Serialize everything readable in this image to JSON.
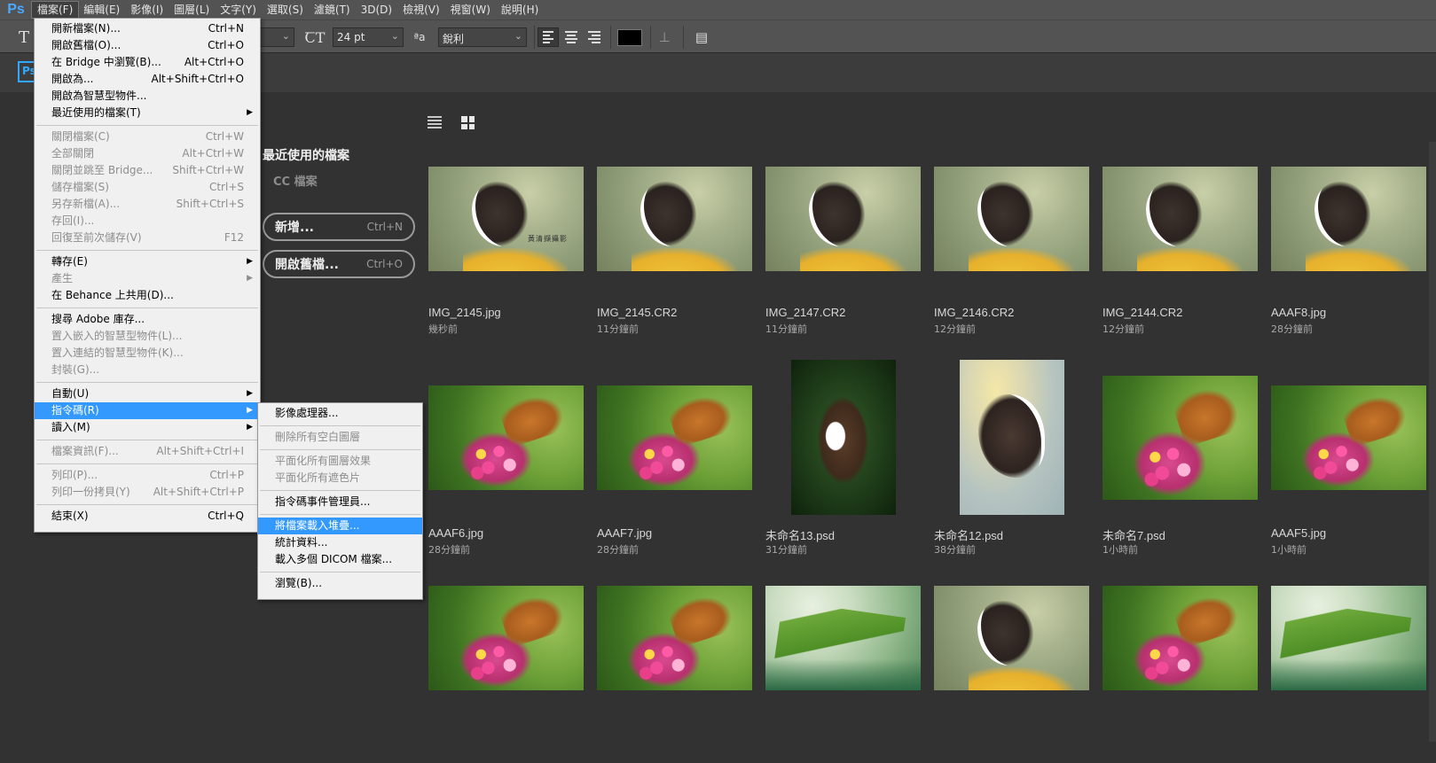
{
  "app": {
    "logo_text": "Ps",
    "accent": "#31a8ff",
    "menu_highlight": "#3399ff"
  },
  "menubar": {
    "items": [
      "檔案(F)",
      "編輯(E)",
      "影像(I)",
      "圖層(L)",
      "文字(Y)",
      "選取(S)",
      "濾鏡(T)",
      "3D(D)",
      "檢視(V)",
      "視窗(W)",
      "說明(H)"
    ]
  },
  "options_bar": {
    "tool_icon": "T",
    "font_size": "24 pt",
    "antialias_label": "ªa",
    "antialias_value": "銳利",
    "text_color": "#000000"
  },
  "home": {
    "tab_icon": "Ps",
    "nav": {
      "recent": "最近使用的檔案",
      "cc": "CC 檔案"
    },
    "buttons": [
      {
        "label": "新增...",
        "shortcut": "Ctrl+N"
      },
      {
        "label": "開啟舊檔...",
        "shortcut": "Ctrl+O"
      }
    ],
    "watermark": "黃清擷攝影",
    "files": [
      {
        "name": "IMG_2145.jpg",
        "time": "幾秒前",
        "img": "butterfly",
        "shape": "landscape"
      },
      {
        "name": "IMG_2145.CR2",
        "time": "11分鐘前",
        "img": "butterfly",
        "shape": "landscape"
      },
      {
        "name": "IMG_2147.CR2",
        "time": "11分鐘前",
        "img": "butterfly",
        "shape": "landscape"
      },
      {
        "name": "IMG_2146.CR2",
        "time": "12分鐘前",
        "img": "butterfly",
        "shape": "landscape"
      },
      {
        "name": "IMG_2144.CR2",
        "time": "12分鐘前",
        "img": "butterfly",
        "shape": "landscape"
      },
      {
        "name": "AAAF8.jpg",
        "time": "28分鐘前",
        "img": "butterfly",
        "shape": "landscape"
      },
      {
        "name": "AAAF6.jpg",
        "time": "28分鐘前",
        "img": "skipper",
        "shape": "landscape"
      },
      {
        "name": "AAAF7.jpg",
        "time": "28分鐘前",
        "img": "skipper",
        "shape": "landscape"
      },
      {
        "name": "未命名13.psd",
        "time": "31分鐘前",
        "img": "portrait-dark",
        "shape": "portrait"
      },
      {
        "name": "未命名12.psd",
        "time": "38分鐘前",
        "img": "portrait-light",
        "shape": "portrait"
      },
      {
        "name": "未命名7.psd",
        "time": "1小時前",
        "img": "skipper",
        "shape": "landscape2"
      },
      {
        "name": "AAAF5.jpg",
        "time": "1小時前",
        "img": "skipper",
        "shape": "landscape"
      },
      {
        "name": "",
        "time": "",
        "img": "skipper",
        "shape": "landscape"
      },
      {
        "name": "",
        "time": "",
        "img": "skipper",
        "shape": "landscape"
      },
      {
        "name": "",
        "time": "",
        "img": "grasshopper",
        "shape": "landscape"
      },
      {
        "name": "",
        "time": "",
        "img": "butterfly",
        "shape": "landscape"
      },
      {
        "name": "",
        "time": "",
        "img": "skipper",
        "shape": "landscape"
      },
      {
        "name": "",
        "time": "",
        "img": "grasshopper",
        "shape": "landscape"
      }
    ]
  },
  "file_menu": {
    "items": [
      {
        "label": "開新檔案(N)...",
        "shortcut": "Ctrl+N"
      },
      {
        "label": "開啟舊檔(O)...",
        "shortcut": "Ctrl+O"
      },
      {
        "label": "在 Bridge 中瀏覽(B)...",
        "shortcut": "Alt+Ctrl+O"
      },
      {
        "label": "開啟為...",
        "shortcut": "Alt+Shift+Ctrl+O"
      },
      {
        "label": "開啟為智慧型物件..."
      },
      {
        "label": "最近使用的檔案(T)",
        "submenu": true
      },
      {
        "sep": true
      },
      {
        "label": "關閉檔案(C)",
        "shortcut": "Ctrl+W",
        "disabled": true
      },
      {
        "label": "全部關閉",
        "shortcut": "Alt+Ctrl+W",
        "disabled": true
      },
      {
        "label": "關閉並跳至 Bridge...",
        "shortcut": "Shift+Ctrl+W",
        "disabled": true
      },
      {
        "label": "儲存檔案(S)",
        "shortcut": "Ctrl+S",
        "disabled": true
      },
      {
        "label": "另存新檔(A)...",
        "shortcut": "Shift+Ctrl+S",
        "disabled": true
      },
      {
        "label": "存回(I)...",
        "disabled": true
      },
      {
        "label": "回復至前次儲存(V)",
        "shortcut": "F12",
        "disabled": true
      },
      {
        "sep": true
      },
      {
        "label": "轉存(E)",
        "submenu": true
      },
      {
        "label": "產生",
        "submenu": true,
        "disabled": true
      },
      {
        "label": "在 Behance 上共用(D)..."
      },
      {
        "sep": true
      },
      {
        "label": "搜尋 Adobe 庫存..."
      },
      {
        "label": "置入嵌入的智慧型物件(L)...",
        "disabled": true
      },
      {
        "label": "置入連結的智慧型物件(K)...",
        "disabled": true
      },
      {
        "label": "封裝(G)...",
        "disabled": true
      },
      {
        "sep": true
      },
      {
        "label": "自動(U)",
        "submenu": true
      },
      {
        "label": "指令碼(R)",
        "submenu": true,
        "highlighted": true
      },
      {
        "label": "讀入(M)",
        "submenu": true
      },
      {
        "sep": true
      },
      {
        "label": "檔案資訊(F)...",
        "shortcut": "Alt+Shift+Ctrl+I",
        "disabled": true
      },
      {
        "sep": true
      },
      {
        "label": "列印(P)...",
        "shortcut": "Ctrl+P",
        "disabled": true
      },
      {
        "label": "列印一份拷貝(Y)",
        "shortcut": "Alt+Shift+Ctrl+P",
        "disabled": true
      },
      {
        "sep": true
      },
      {
        "label": "結束(X)",
        "shortcut": "Ctrl+Q"
      }
    ]
  },
  "script_submenu": {
    "items": [
      {
        "label": "影像處理器..."
      },
      {
        "sep": true
      },
      {
        "label": "刪除所有空白圖層",
        "disabled": true
      },
      {
        "sep": true
      },
      {
        "label": "平面化所有圖層效果",
        "disabled": true
      },
      {
        "label": "平面化所有遮色片",
        "disabled": true
      },
      {
        "sep": true
      },
      {
        "label": "指令碼事件管理員..."
      },
      {
        "sep": true
      },
      {
        "label": "將檔案載入堆疊...",
        "highlighted": true
      },
      {
        "label": "統計資料..."
      },
      {
        "label": "載入多個 DICOM 檔案..."
      },
      {
        "sep": true
      },
      {
        "label": "瀏覽(B)..."
      }
    ]
  }
}
